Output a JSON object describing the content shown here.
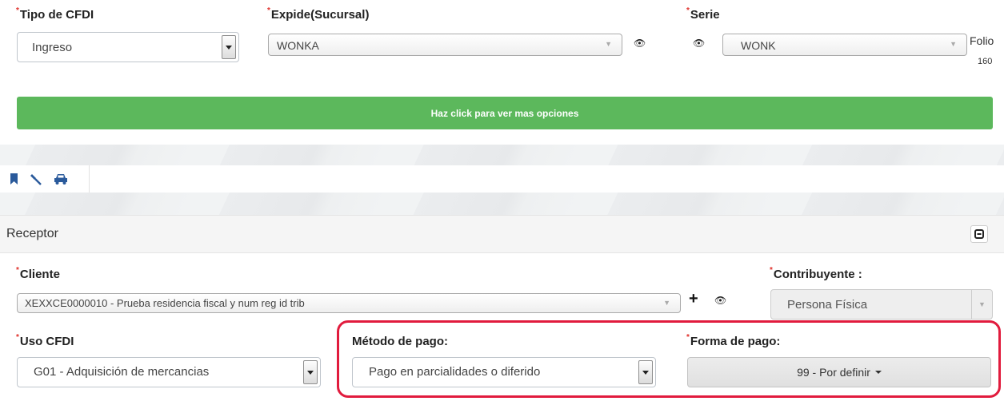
{
  "tipo_cfdi": {
    "label": "Tipo de CFDI",
    "value": "Ingreso"
  },
  "expide": {
    "label": "Expide(Sucursal)",
    "value": "WONKA"
  },
  "serie": {
    "label": "Serie",
    "value": "WONK"
  },
  "folio": {
    "label": "Folio",
    "value": "160"
  },
  "more_options": {
    "label": "Haz click para ver mas opciones"
  },
  "toolbar": {
    "icons": [
      "bookmark-icon",
      "gavel-icon",
      "car-icon"
    ]
  },
  "receptor": {
    "title": "Receptor",
    "collapse_icon": "minus-square-icon"
  },
  "cliente": {
    "label": "Cliente",
    "value": "XEXXCE0000010 - Prueba residencia fiscal y num reg id trib"
  },
  "contribuyente": {
    "label": "Contribuyente :",
    "value": "Persona Física"
  },
  "uso_cfdi": {
    "label": "Uso CFDI",
    "value": "G01 - Adquisición de mercancias"
  },
  "metodo_pago": {
    "label": "Método de pago:",
    "value": "Pago en parcialidades o diferido"
  },
  "forma_pago": {
    "label": "Forma de pago:",
    "value": "99 - Por definir"
  },
  "colors": {
    "green": "#5cb85c",
    "required": "#e0302a",
    "highlight": "#e11b3d",
    "icon_blue": "#2a5a9b"
  }
}
